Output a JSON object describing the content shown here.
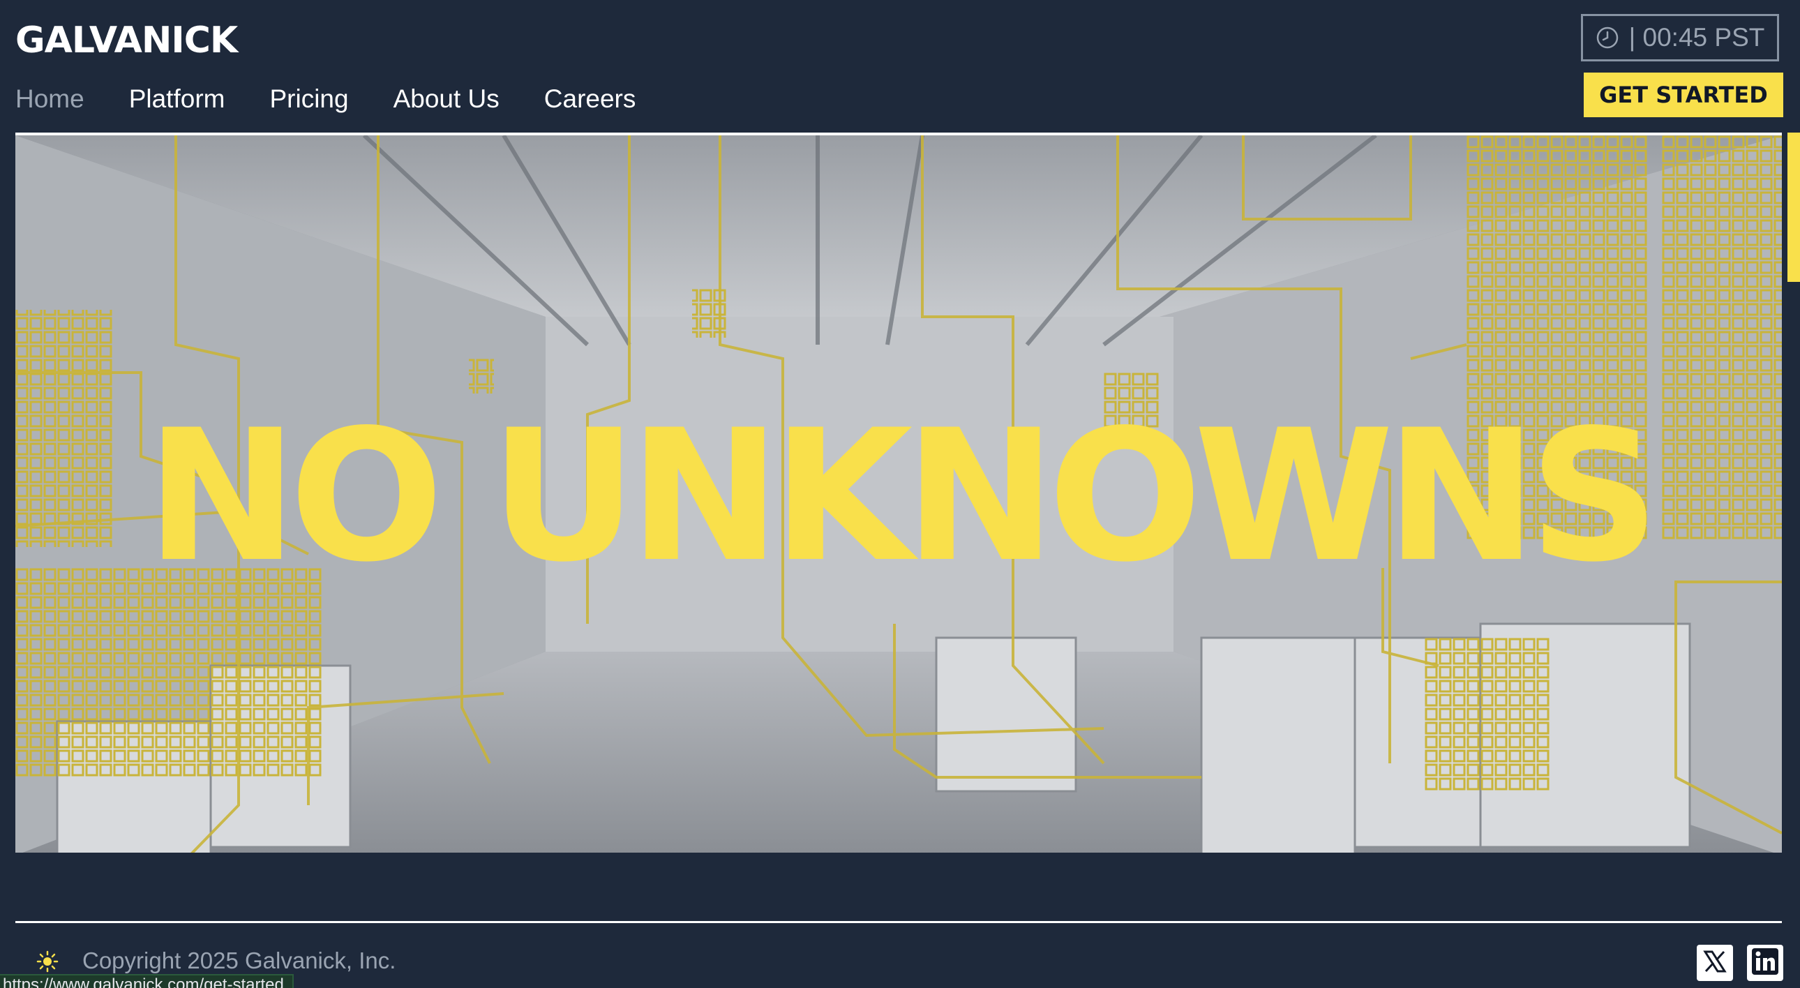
{
  "brand": {
    "logo": "GALVANICK"
  },
  "nav": {
    "items": [
      {
        "label": "Home",
        "active": true
      },
      {
        "label": "Platform",
        "active": false
      },
      {
        "label": "Pricing",
        "active": false
      },
      {
        "label": "About Us",
        "active": false
      },
      {
        "label": "Careers",
        "active": false
      }
    ]
  },
  "clock": {
    "icon": "clock-icon",
    "text": "| 00:45 PST"
  },
  "cta": {
    "label": "GET STARTED"
  },
  "hero": {
    "headline": "NO UNKNOWNS",
    "image": "cleanroom-factory-photo"
  },
  "footer": {
    "theme_icon": "sun-icon",
    "copyright": "Copyright 2025 Galvanick, Inc.",
    "social": [
      {
        "name": "x",
        "icon": "x-logo-icon"
      },
      {
        "name": "linkedin",
        "icon": "linkedin-logo-icon"
      }
    ]
  },
  "status_bar": {
    "url": "https://www.galvanick.com/get-started"
  },
  "colors": {
    "background": "#1e293b",
    "accent": "#f9e04b",
    "muted_text": "#9aa4b2"
  }
}
